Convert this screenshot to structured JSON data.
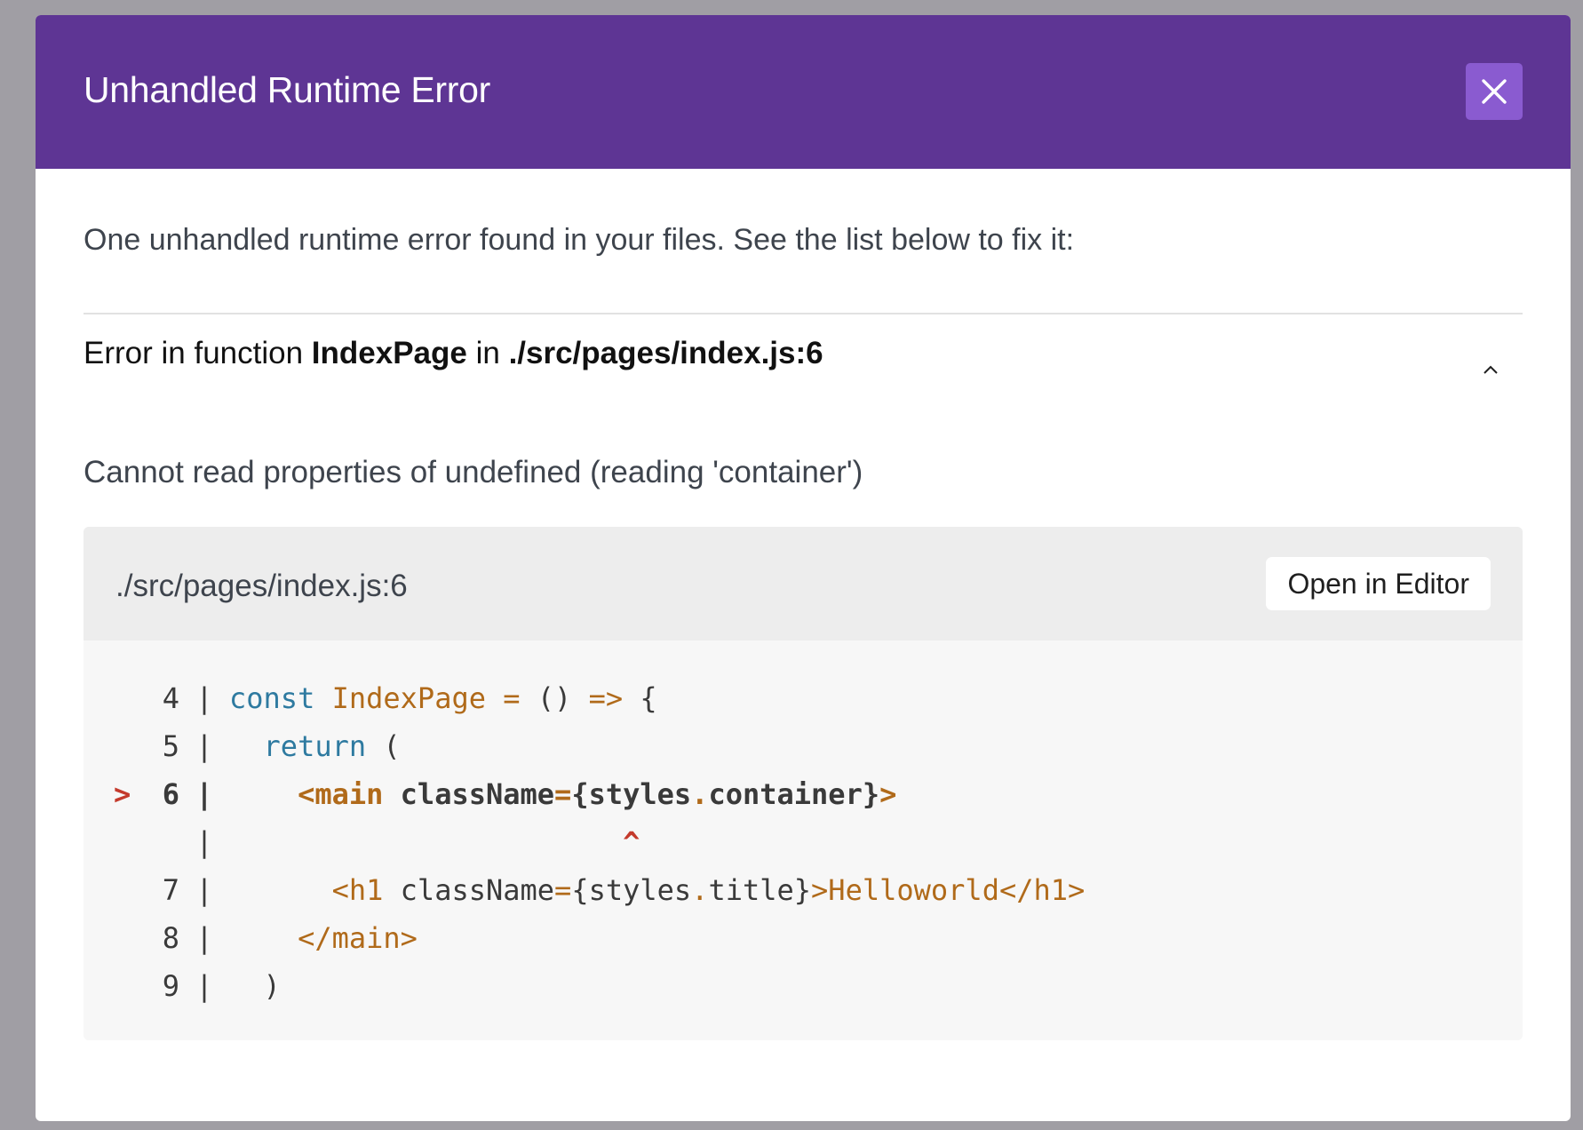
{
  "header": {
    "title": "Unhandled Runtime Error",
    "close_icon": "close-icon"
  },
  "summary": "One unhandled runtime error found in your files. See the list below to fix it:",
  "error": {
    "prefix": "Error in function ",
    "function_name": "IndexPage",
    "middle": " in ",
    "location": "./src/pages/index.js:6",
    "toggle_icon": "chevron-up-icon",
    "message": "Cannot read properties of undefined (reading 'container')"
  },
  "code_frame": {
    "path": "./src/pages/index.js:6",
    "open_editor_label": "Open in Editor",
    "marker": ">",
    "gutter": "|",
    "lines": [
      {
        "number": "4",
        "indent": "",
        "tokens": [
          {
            "text": "const",
            "cls": "kw"
          },
          {
            "text": " ",
            "cls": "punct"
          },
          {
            "text": "IndexPage",
            "cls": "ident"
          },
          {
            "text": " ",
            "cls": "punct"
          },
          {
            "text": "=",
            "cls": "op"
          },
          {
            "text": " () ",
            "cls": "punct"
          },
          {
            "text": "=>",
            "cls": "op"
          },
          {
            "text": " {",
            "cls": "punct"
          }
        ]
      },
      {
        "number": "5",
        "indent": "  ",
        "tokens": [
          {
            "text": "return",
            "cls": "kw"
          },
          {
            "text": " (",
            "cls": "punct"
          }
        ]
      },
      {
        "number": "6",
        "indent": "    ",
        "tokens": [
          {
            "text": "<main",
            "cls": "tag"
          },
          {
            "text": " className",
            "cls": "attr"
          },
          {
            "text": "=",
            "cls": "op"
          },
          {
            "text": "{styles",
            "cls": "punct"
          },
          {
            "text": ".",
            "cls": "op"
          },
          {
            "text": "container}",
            "cls": "punct"
          },
          {
            "text": ">",
            "cls": "tag"
          }
        ]
      },
      {
        "number": "7",
        "indent": "      ",
        "tokens": [
          {
            "text": "<h1",
            "cls": "tag"
          },
          {
            "text": " className",
            "cls": "attr"
          },
          {
            "text": "=",
            "cls": "op"
          },
          {
            "text": "{styles",
            "cls": "punct"
          },
          {
            "text": ".",
            "cls": "op"
          },
          {
            "text": "title}",
            "cls": "punct"
          },
          {
            "text": ">Helloworld</h1>",
            "cls": "tag"
          }
        ]
      },
      {
        "number": "8",
        "indent": "    ",
        "tokens": [
          {
            "text": "</main>",
            "cls": "tag"
          }
        ]
      },
      {
        "number": "9",
        "indent": "  ",
        "tokens": [
          {
            "text": ")",
            "cls": "punct"
          }
        ]
      }
    ],
    "caret": "^",
    "caret_indent": "                       "
  },
  "colors": {
    "header_bg": "#5e3594",
    "close_button_bg": "#8a5bd0",
    "keyword": "#2e7aa0",
    "tag": "#b06a1a",
    "error_marker": "#c43a2c"
  }
}
